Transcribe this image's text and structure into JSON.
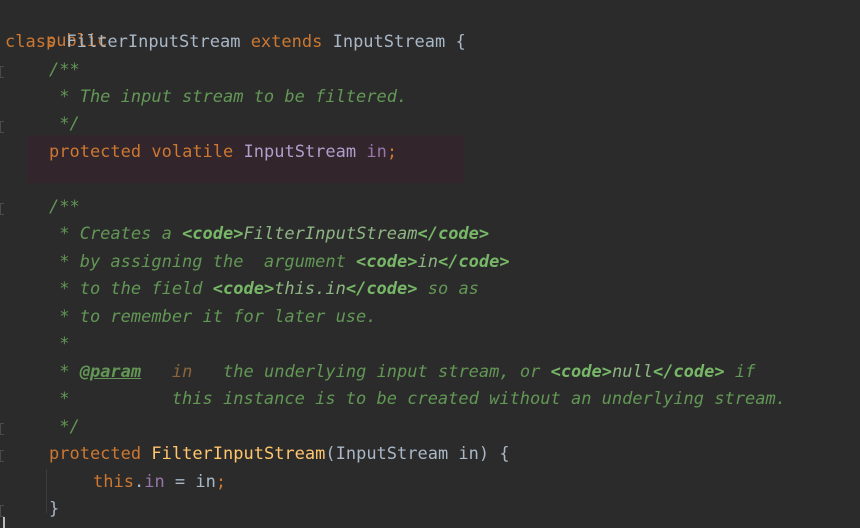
{
  "code": {
    "l1": {
      "kw": "public"
    },
    "l2": {
      "kw1": "class",
      "name": "FilterInputStream",
      "kw2": "extends",
      "base": "InputStream",
      "brace": "{"
    },
    "l3": {
      "c": "/**"
    },
    "l4": {
      "c": " * The input stream to be filtered."
    },
    "l5": {
      "c": " */"
    },
    "l6": {
      "kw1": "protected",
      "kw2": "volatile",
      "type": "InputStream",
      "field": "in",
      "semi": ";"
    },
    "l8": {
      "c": "/**"
    },
    "l9": {
      "pre": " * Creates a ",
      "t1": "<code>",
      "mid": "FilterInputStream",
      "t2": "</code>"
    },
    "l10": {
      "pre": " * by assigning the  argument ",
      "t1": "<code>",
      "mid": "in",
      "t2": "</code>"
    },
    "l11": {
      "pre": " * to the field ",
      "t1": "<code>",
      "mid": "this.in",
      "t2": "</code>",
      "post": " so as"
    },
    "l12": {
      "c": " * to remember it for later use."
    },
    "l13": {
      "c": " *"
    },
    "l14": {
      "pre": " * ",
      "ann": "@param",
      "gap": "   ",
      "pn": "in",
      "mid": "   the underlying input stream, or ",
      "t1": "<code>",
      "nul": "null",
      "t2": "</code>",
      "post": " if"
    },
    "l15": {
      "c": " *          this instance is to be created without an underlying stream."
    },
    "l16": {
      "c": " */"
    },
    "l17": {
      "kw": "protected",
      "fn": "FilterInputStream",
      "params": "(InputStream in) {"
    },
    "l18": {
      "kw": "this",
      "dot": ".",
      "field": "in",
      "rest": " = in",
      "semi": ";"
    },
    "l19": {
      "c": "}"
    }
  }
}
